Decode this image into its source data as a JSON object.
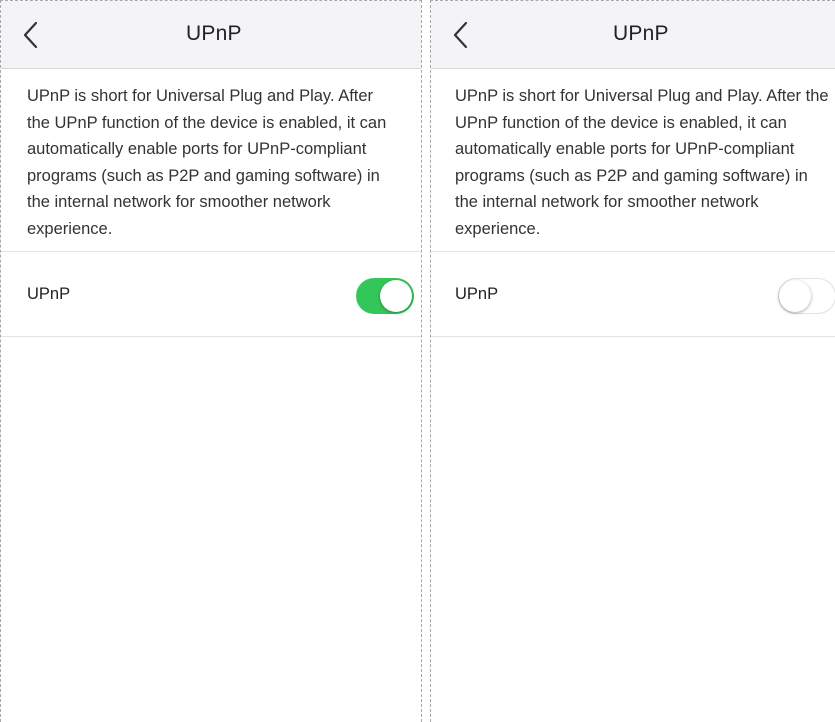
{
  "screens": [
    {
      "title": "UPnP",
      "description": "UPnP is short for Universal Plug and Play. After the UPnP function of the device is enabled, it can automatically enable ports for UPnP-compliant programs (such as P2P and gaming software) in the internal network for smoother network experience.",
      "setting_label": "UPnP",
      "toggle_state": "on"
    },
    {
      "title": "UPnP",
      "description": "UPnP is short for Universal Plug and Play. After the UPnP function of the device is enabled, it can automatically enable ports for UPnP-compliant programs (such as P2P and gaming software) in the internal network for smoother network experience.",
      "setting_label": "UPnP",
      "toggle_state": "off"
    }
  ],
  "icons": {
    "back": "chevron-left-icon"
  },
  "colors": {
    "toggle_on": "#33c759",
    "toggle_off": "#ffffff",
    "nav_bg": "#f4f4f6"
  }
}
